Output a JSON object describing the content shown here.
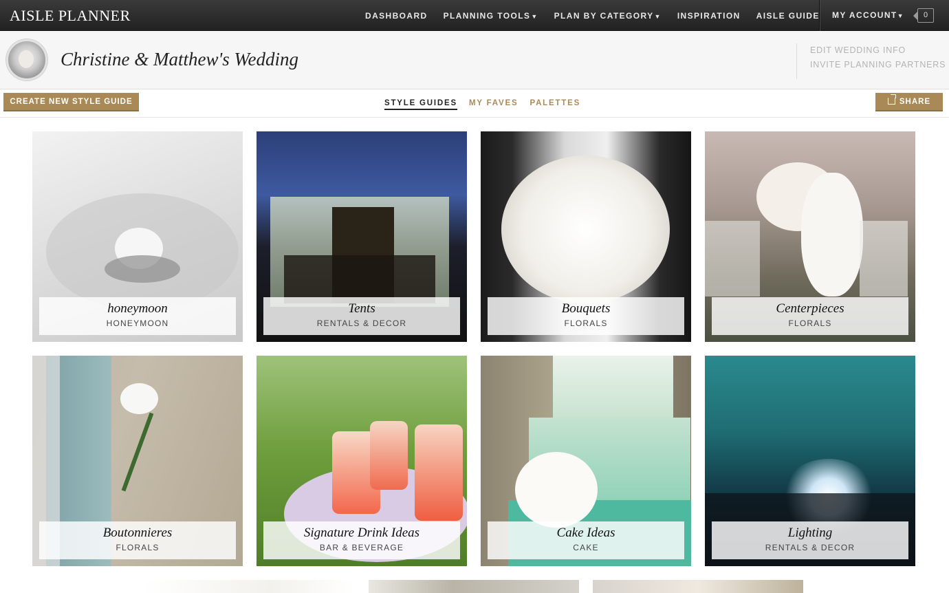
{
  "nav": {
    "logo": "AISLE PLANNER",
    "items": [
      {
        "label": "DASHBOARD",
        "caret": ""
      },
      {
        "label": "PLANNING TOOLS",
        "caret": "▼"
      },
      {
        "label": "PLAN BY CATEGORY",
        "caret": "▼"
      },
      {
        "label": "INSPIRATION",
        "caret": ""
      },
      {
        "label": "AISLE GUIDE",
        "caret": ""
      }
    ],
    "account": "MY ACCOUNT",
    "account_caret": "▼",
    "cart_count": "0"
  },
  "wedding": {
    "title": "Christine & Matthew's Wedding",
    "edit_link": "EDIT WEDDING INFO",
    "invite_link": "INVITE PLANNING PARTNERS"
  },
  "toolbar": {
    "create_label": "CREATE NEW STYLE GUIDE",
    "share_label": "SHARE",
    "tabs": [
      {
        "label": "STYLE GUIDES",
        "active": true
      },
      {
        "label": "MY FAVES",
        "active": false
      },
      {
        "label": "PALETTES",
        "active": false
      }
    ]
  },
  "style_guides": [
    {
      "title": "honeymoon",
      "category": "HONEYMOON"
    },
    {
      "title": "Tents",
      "category": "RENTALS & DECOR"
    },
    {
      "title": "Bouquets",
      "category": "FLORALS"
    },
    {
      "title": "Centerpieces",
      "category": "FLORALS"
    },
    {
      "title": "Boutonnieres",
      "category": "FLORALS"
    },
    {
      "title": "Signature Drink Ideas",
      "category": "BAR & BEVERAGE"
    },
    {
      "title": "Cake Ideas",
      "category": "CAKE"
    },
    {
      "title": "Lighting",
      "category": "RENTALS & DECOR"
    }
  ],
  "colors": {
    "accent_gold": "#a98a57",
    "nav_bg": "#2a2a2a"
  }
}
